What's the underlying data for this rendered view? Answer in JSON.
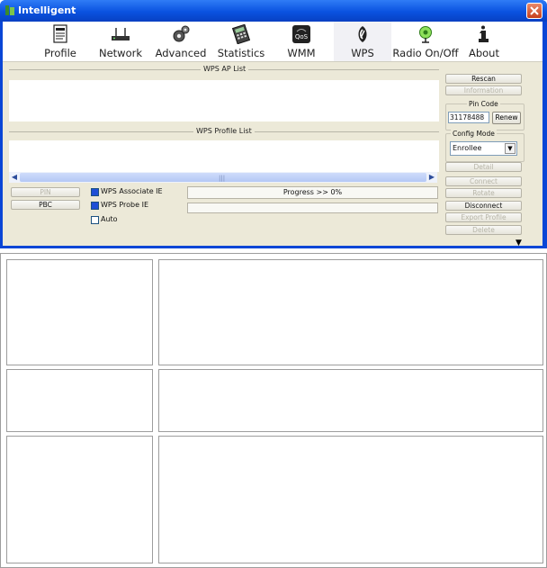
{
  "window": {
    "title": "Intelligent"
  },
  "toolbar": {
    "items": [
      {
        "label": "Profile",
        "icon": "profile-icon"
      },
      {
        "label": "Network",
        "icon": "network-icon"
      },
      {
        "label": "Advanced",
        "icon": "advanced-icon"
      },
      {
        "label": "Statistics",
        "icon": "statistics-icon"
      },
      {
        "label": "WMM",
        "icon": "wmm-icon"
      },
      {
        "label": "WPS",
        "icon": "wps-icon",
        "selected": true
      },
      {
        "label": "Radio On/Off",
        "icon": "radio-icon"
      },
      {
        "label": "About",
        "icon": "about-icon"
      }
    ]
  },
  "wps": {
    "ap_list_title": "WPS AP List",
    "profile_list_title": "WPS Profile List",
    "rescan": "Rescan",
    "information": "Information",
    "pin_code_label": "Pin Code",
    "pin_code_value": "31178488",
    "renew": "Renew",
    "config_mode_label": "Config Mode",
    "config_mode_value": "Enrollee",
    "detail": "Detail",
    "connect": "Connect",
    "rotate": "Rotate",
    "disconnect": "Disconnect",
    "export_profile": "Export Profile",
    "delete": "Delete",
    "pin": "PIN",
    "pbc": "PBC",
    "associate_ie": "WPS Associate IE",
    "probe_ie": "WPS Probe IE",
    "auto": "Auto",
    "progress": "Progress >> 0%"
  },
  "colors": {
    "titlebar": "#0a52e0",
    "face": "#ece9d8",
    "checkbox": "#1f4fd6"
  }
}
